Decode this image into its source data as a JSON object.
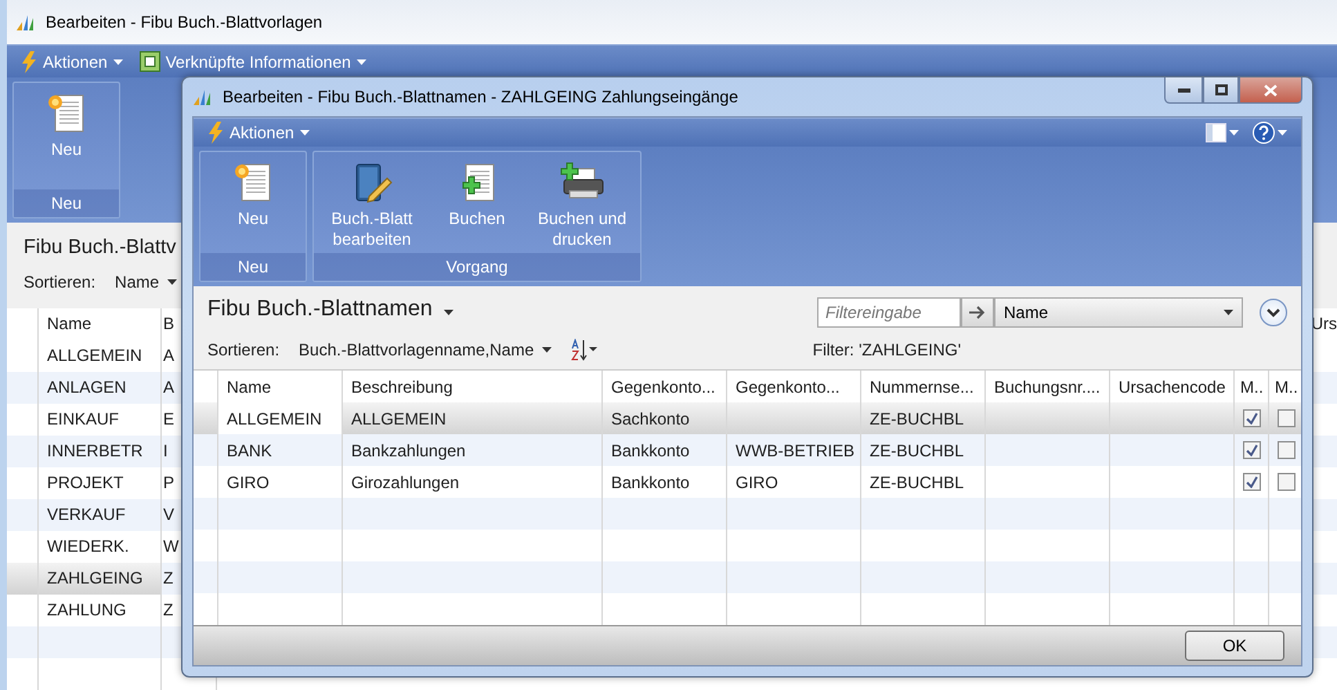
{
  "background_window": {
    "title": "Bearbeiten - Fibu Buch.-Blattvorlagen",
    "action_menu": [
      {
        "label": "Aktionen",
        "kind": "actions"
      },
      {
        "label": "Verknüpfte Informationen",
        "kind": "related"
      }
    ],
    "ribbon": [
      {
        "label": "Neu",
        "buttons": [
          {
            "label": "Neu",
            "kind": "new"
          }
        ]
      }
    ],
    "page_title": "Fibu Buch.-Blattv",
    "sort": {
      "label": "Sortieren:",
      "value": "Name"
    },
    "table": {
      "columns": [
        "Name",
        "B"
      ],
      "cut_column": "Urs",
      "rows": [
        {
          "name": "ALLGEMEIN",
          "column_2": "A",
          "selected": false
        },
        {
          "name": "ANLAGEN",
          "column_2": "A",
          "selected": false
        },
        {
          "name": "EINKAUF",
          "column_2": "E",
          "selected": false
        },
        {
          "name": "INNERBETR",
          "column_2": "I",
          "selected": false
        },
        {
          "name": "PROJEKT",
          "column_2": "P",
          "selected": false
        },
        {
          "name": "VERKAUF",
          "column_2": "V",
          "selected": false
        },
        {
          "name": "WIEDERK.",
          "column_2": "W",
          "selected": false
        },
        {
          "name": "ZAHLGEING",
          "column_2": "Z",
          "selected": true
        },
        {
          "name": "ZAHLUNG",
          "column_2": "Z",
          "selected": false
        }
      ]
    }
  },
  "dialog": {
    "title": "Bearbeiten - Fibu Buch.-Blattnamen - ZAHLGEING Zahlungseingänge",
    "action_menu": [
      {
        "label": "Aktionen",
        "kind": "actions"
      }
    ],
    "ribbon": [
      {
        "label": "Neu",
        "buttons": [
          {
            "label": "Neu",
            "kind": "new"
          }
        ]
      },
      {
        "label": "Vorgang",
        "buttons": [
          {
            "label": "Buch.-Blatt bearbeiten",
            "kind": "edit"
          },
          {
            "label": "Buchen",
            "kind": "post"
          },
          {
            "label": "Buchen und drucken",
            "kind": "print"
          }
        ]
      }
    ],
    "page_title": "Fibu Buch.-Blattnamen",
    "filter": {
      "placeholder": "Filtereingabe",
      "field": "Name",
      "applied": "Filter: 'ZAHLGEING'"
    },
    "sort": {
      "label": "Sortieren:",
      "value": "Buch.-Blattvorlagenname,Name"
    },
    "table": {
      "columns": [
        "Name",
        "Beschreibung",
        "Gegenkonto...",
        "Gegenkonto...",
        "Nummernse...",
        "Buchungsnr....",
        "Ursachencode",
        "M..",
        "M.."
      ],
      "rows": [
        {
          "cells": [
            "ALLGEMEIN",
            "ALLGEMEIN",
            "Sachkonto",
            "",
            "ZE-BUCHBL",
            "",
            ""
          ],
          "checks": [
            {
              "checked": true
            },
            {
              "checked": false
            }
          ],
          "selected": true
        },
        {
          "cells": [
            "BANK",
            "Bankzahlungen",
            "Bankkonto",
            "WWB-BETRIEB",
            "ZE-BUCHBL",
            "",
            ""
          ],
          "checks": [
            {
              "checked": true
            },
            {
              "checked": false
            }
          ],
          "selected": false
        },
        {
          "cells": [
            "GIRO",
            "Girozahlungen",
            "Bankkonto",
            "GIRO",
            "ZE-BUCHBL",
            "",
            ""
          ],
          "checks": [
            {
              "checked": true
            },
            {
              "checked": false
            }
          ],
          "selected": false
        }
      ]
    },
    "ok_button": "OK"
  }
}
